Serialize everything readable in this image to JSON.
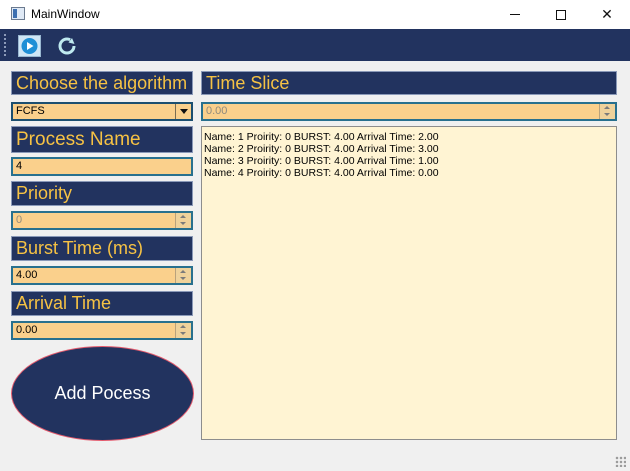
{
  "window": {
    "title": "MainWindow",
    "close_glyph": "✕"
  },
  "toolbar": {
    "play_icon": "play-icon",
    "reset_icon": "refresh-icon"
  },
  "form": {
    "algorithm_label": "Choose the algorithm",
    "algorithm_value": "FCFS",
    "process_name_label": "Process Name",
    "process_name_value": "4",
    "priority_label": "Priority",
    "priority_value": "0",
    "burst_label": "Burst Time (ms)",
    "burst_value": "4.00",
    "arrival_label": "Arrival Time",
    "arrival_value": "0.00",
    "add_button": "Add Pocess"
  },
  "time_slice": {
    "label": "Time Slice",
    "value": "0.00"
  },
  "processes": [
    "Name: 1 Proirity: 0 BURST: 4.00 Arrival Time: 2.00",
    "Name: 2 Proirity: 0 BURST: 4.00 Arrival Time: 3.00",
    "Name: 3 Proirity: 0 BURST: 4.00 Arrival Time: 1.00",
    "Name: 4 Proirity: 0 BURST: 4.00 Arrival Time: 0.00"
  ],
  "colors": {
    "toolbar_bg": "#22335f",
    "label_text": "#f6c244",
    "field_bg": "#fad08c",
    "output_bg": "#fff4d3"
  }
}
